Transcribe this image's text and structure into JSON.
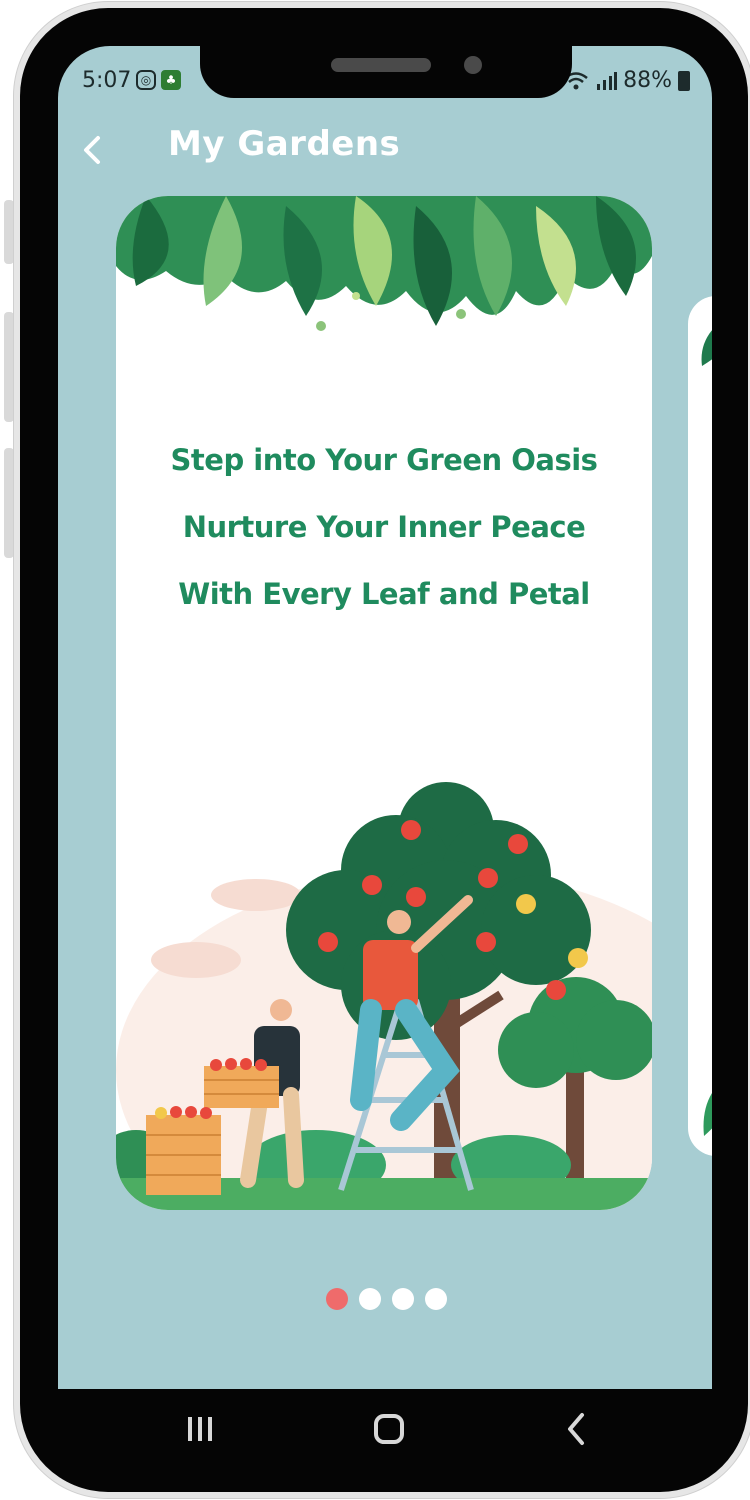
{
  "status_bar": {
    "time": "5:07",
    "battery": "88%",
    "left_icons": [
      "instagram-icon",
      "plant-app-icon",
      "notification-icon"
    ],
    "right_icons": [
      "wifi-icon",
      "signal-icon",
      "battery-charging-icon"
    ]
  },
  "header": {
    "title": "My Gardens",
    "back_icon": "chevron-left-icon"
  },
  "carousel": {
    "slide": {
      "lines": [
        "Step into Your Green Oasis",
        "Nurture Your Inner Peace",
        "With Every Leaf and Petal"
      ]
    },
    "page_count": 4,
    "active_index": 0
  },
  "nav_bar": {
    "buttons": [
      "recent-apps-icon",
      "home-icon",
      "back-icon"
    ]
  },
  "colors": {
    "background": "#a7cdd2",
    "text_green": "#1f8b5e",
    "dot_active": "#ef6b6b",
    "dot_inactive": "#ffffff"
  }
}
